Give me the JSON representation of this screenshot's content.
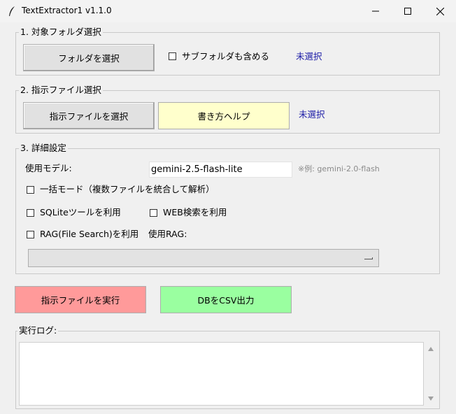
{
  "window": {
    "title": "TextExtractor1 v1.1.0",
    "icon": "feather-icon",
    "controls": [
      "minimize-icon",
      "maximize-icon",
      "close-icon"
    ]
  },
  "section1": {
    "label": "1. 対象フォルダ選択",
    "select_button": "フォルダを選択",
    "subfolder_checkbox_label": "サブフォルダも含める",
    "subfolder_checked": false,
    "status": "未選択"
  },
  "section2": {
    "label": "2. 指示ファイル選択",
    "select_button": "指示ファイルを選択",
    "help_button": "書き方ヘルプ",
    "status": "未選択"
  },
  "section3": {
    "label": "3. 詳細設定",
    "model_label": "使用モデル:",
    "model_value": "gemini-2.5-flash-lite",
    "model_hint": "※例: gemini-2.0-flash",
    "batch_mode_label": "一括モード（複数ファイルを統合して解析）",
    "batch_mode_checked": false,
    "sqlite_label": "SQLiteツールを利用",
    "sqlite_checked": false,
    "web_search_label": "WEB検索を利用",
    "web_search_checked": false,
    "rag_label": "RAG(File Search)を利用",
    "rag_checked": false,
    "rag_select_label": "使用RAG:",
    "rag_select_value": ""
  },
  "actions": {
    "run_button": "指示ファイルを実行",
    "csv_button": "DBをCSV出力"
  },
  "log": {
    "label": "実行ログ:",
    "content": ""
  },
  "colors": {
    "run_button_bg": "#ff9a9a",
    "csv_button_bg": "#9affa0",
    "help_button_bg": "#ffffcc",
    "status_text": "#1a1aa6"
  }
}
